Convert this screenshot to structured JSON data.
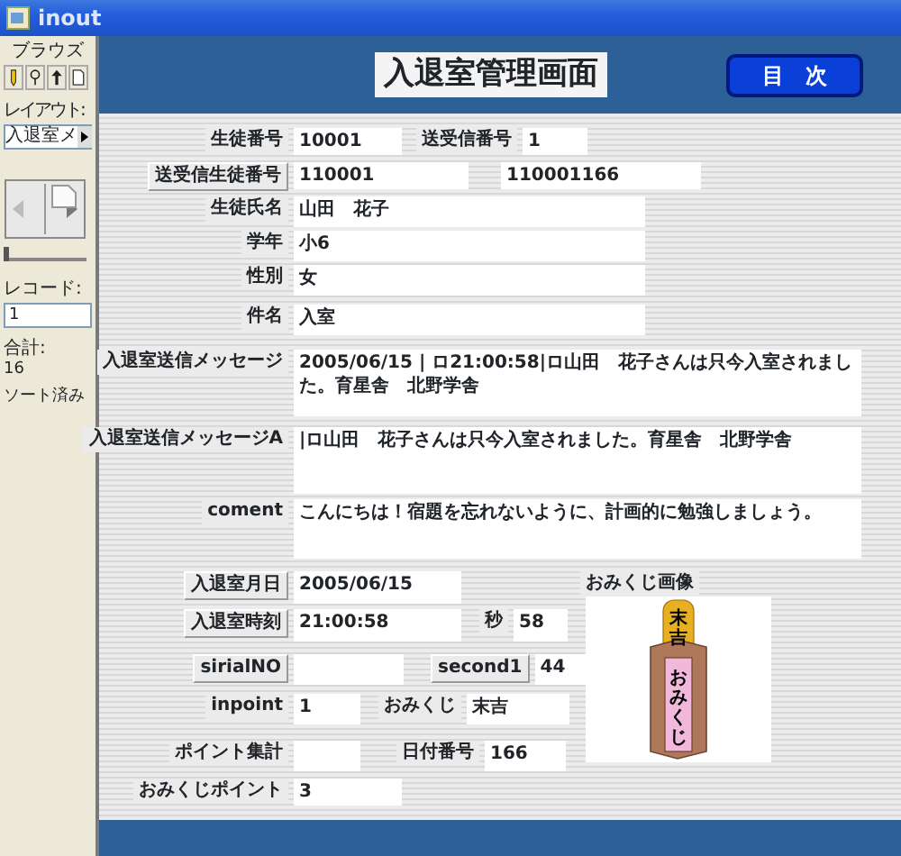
{
  "window": {
    "title": "inout"
  },
  "sidebar": {
    "mode": "ブラウズ",
    "layout_label": "レイアウト:",
    "layout_value": "入退室メ",
    "record_slider": {
      "level": 0
    },
    "record_label": "レコード:",
    "record_value": "1",
    "total_label": "合計:",
    "total_value": "16",
    "sort_status": "ソート済み"
  },
  "header": {
    "title": "入退室管理画面",
    "menu_button": "目　次"
  },
  "form_rows": [
    {
      "fields": [
        {
          "label": "生徒番号",
          "kind": "label",
          "value": "10001"
        },
        {
          "label": "送受信番号",
          "kind": "label",
          "value": "1"
        }
      ]
    },
    {
      "fields": [
        {
          "label": "送受信生徒番号",
          "kind": "button",
          "value": "110001"
        },
        {
          "value": "110001166"
        }
      ]
    },
    {
      "fields": [
        {
          "label": "生徒氏名",
          "kind": "label",
          "value": "山田　花子"
        }
      ]
    },
    {
      "fields": [
        {
          "label": "学年",
          "kind": "label",
          "value": "小6"
        }
      ]
    },
    {
      "fields": [
        {
          "label": "性別",
          "kind": "label",
          "value": "女"
        }
      ]
    },
    {
      "fields": [
        {
          "label": "件名",
          "kind": "label",
          "value": "入室"
        }
      ]
    },
    {
      "fields": [
        {
          "label": "入退室送信メッセージ",
          "kind": "label",
          "value": "2005/06/15 | ロ21:00:58|ロ山田　花子さんは只今入室されました。育星舎　北野学舎"
        }
      ]
    },
    {
      "fields": [
        {
          "label": "入退室送信メッセージA",
          "kind": "label",
          "value": "|ロ山田　花子さんは只今入室されました。育星舎　北野学舎"
        }
      ]
    },
    {
      "fields": [
        {
          "label": "coment",
          "kind": "label",
          "value": "こんにちは！宿題を忘れないように、計画的に勉強しましょう。"
        }
      ]
    },
    {
      "fields": [
        {
          "label": "入退室月日",
          "kind": "button",
          "value": "2005/06/15"
        }
      ]
    },
    {
      "fields": [
        {
          "label": "入退室時刻",
          "kind": "button",
          "value": "21:00:58"
        },
        {
          "label": "秒",
          "kind": "label",
          "value": "58"
        }
      ]
    },
    {
      "fields": [
        {
          "label": "sirialNO",
          "kind": "button"
        },
        {
          "label": "second1",
          "kind": "button",
          "value": "44"
        }
      ]
    },
    {
      "fields": [
        {
          "label": "inpoint",
          "kind": "label",
          "value": "1"
        },
        {
          "label": "おみくじ",
          "kind": "label",
          "value": "末吉"
        }
      ]
    },
    {
      "fields": [
        {
          "label": "ポイント集計",
          "kind": "label"
        },
        {
          "label": "日付番号",
          "kind": "label",
          "value": "166"
        }
      ]
    },
    {
      "fields": [
        {
          "label": "おみくじポイント",
          "kind": "label",
          "value": "3"
        }
      ]
    }
  ],
  "omikuji_image": {
    "label": "おみくじ画像",
    "stick_text": "末吉",
    "box_text": "おみくじ"
  }
}
